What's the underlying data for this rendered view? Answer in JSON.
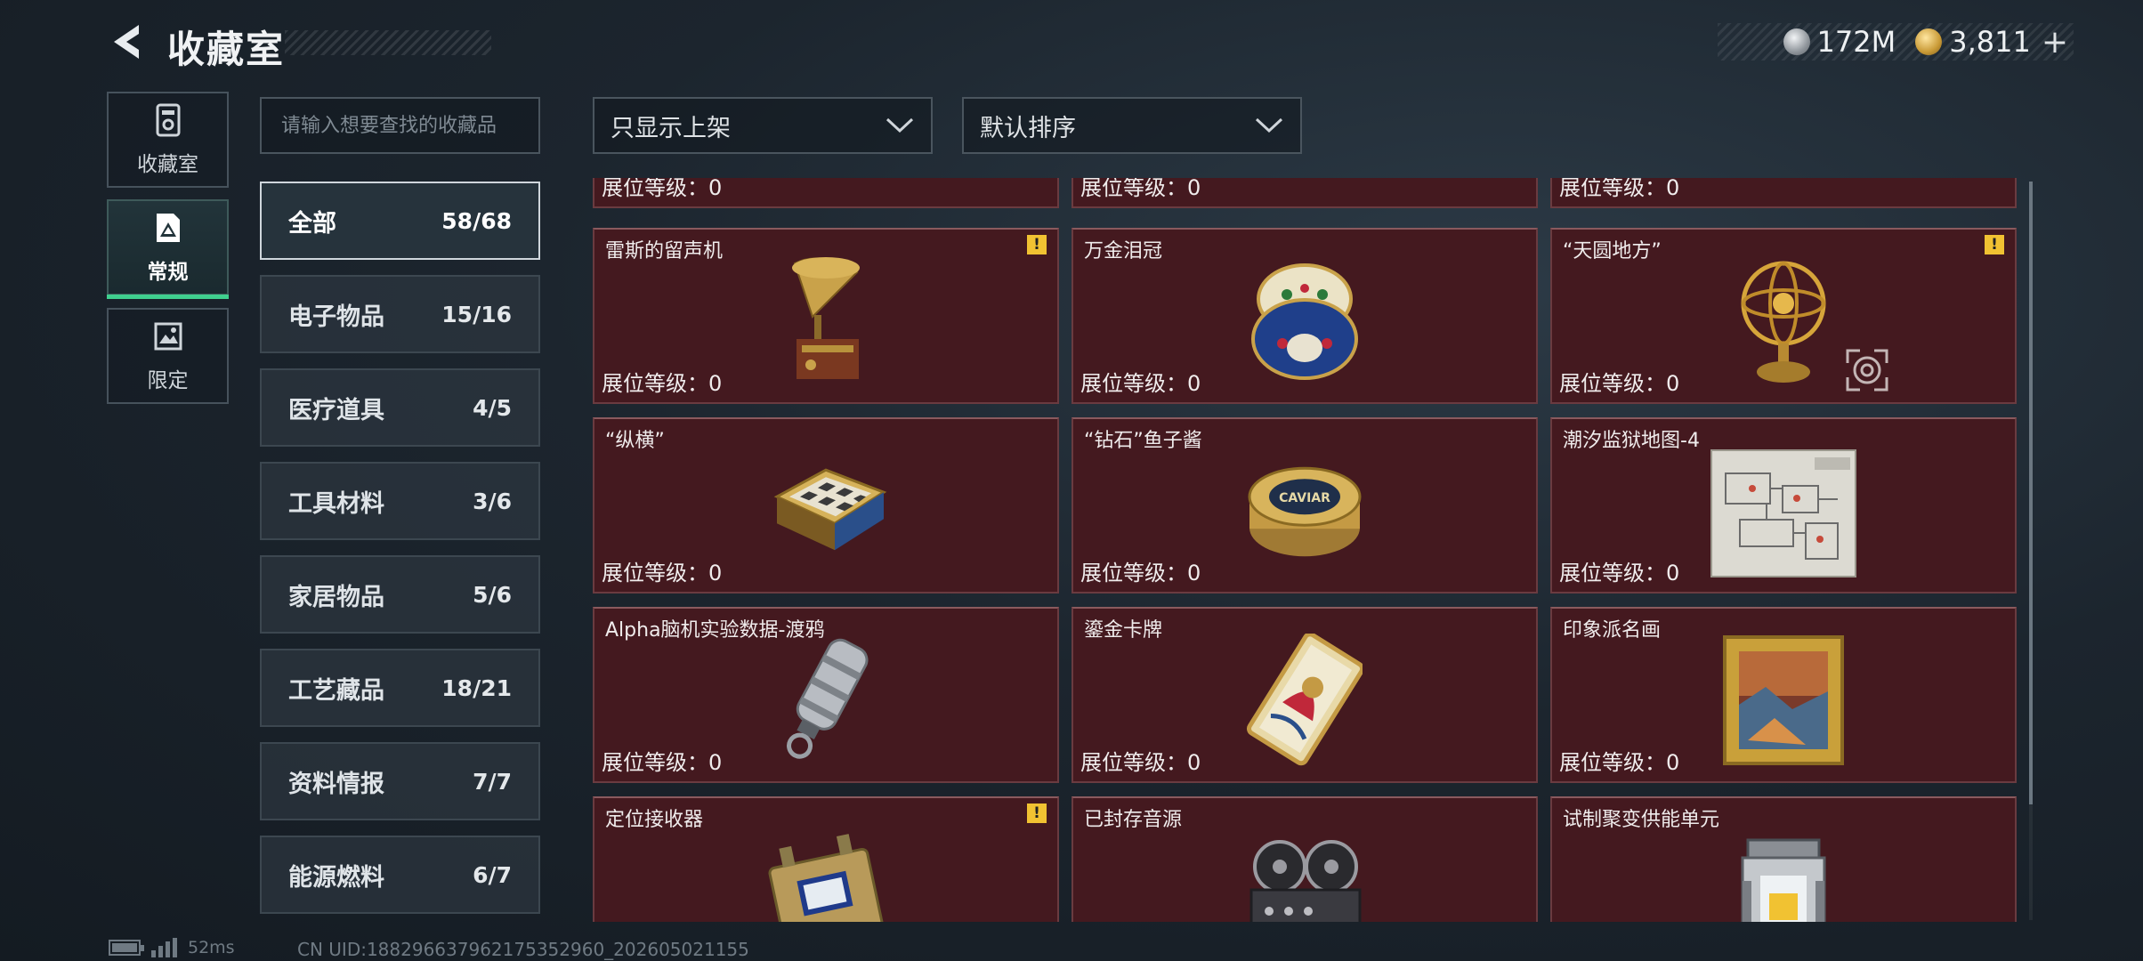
{
  "header": {
    "title": "收藏室",
    "currencies": [
      {
        "icon": "silver-coin-icon",
        "value": "172M"
      },
      {
        "icon": "gold-token-icon",
        "value": "3,811"
      }
    ],
    "add_symbol": "+"
  },
  "modes": [
    {
      "label": "收藏室",
      "icon": "collection-room-icon"
    },
    {
      "label": "常规",
      "icon": "regular-tab-icon",
      "active": true
    },
    {
      "label": "限定",
      "icon": "limited-tab-icon"
    }
  ],
  "search": {
    "placeholder": "请输入想要查找的收藏品"
  },
  "filters": {
    "availability": "只显示上架",
    "sort": "默认排序"
  },
  "categories": [
    {
      "name": "全部",
      "count": "58/68",
      "active": true
    },
    {
      "name": "电子物品",
      "count": "15/16"
    },
    {
      "name": "医疗道具",
      "count": "4/5"
    },
    {
      "name": "工具材料",
      "count": "3/6"
    },
    {
      "name": "家居物品",
      "count": "5/6"
    },
    {
      "name": "工艺藏品",
      "count": "18/21"
    },
    {
      "name": "资料情报",
      "count": "7/7"
    },
    {
      "name": "能源燃料",
      "count": "6/7"
    }
  ],
  "level_prefix": "展位等级：",
  "items": [
    {
      "name": "",
      "level": "0"
    },
    {
      "name": "",
      "level": "0"
    },
    {
      "name": "",
      "level": "0"
    },
    {
      "name": "雷斯的留声机",
      "level": "0",
      "alert": "!"
    },
    {
      "name": "万金泪冠",
      "level": "0"
    },
    {
      "name": "“天圆地方”",
      "level": "0",
      "alert": "!"
    },
    {
      "name": "“纵横”",
      "level": "0"
    },
    {
      "name": "“钻石”鱼子酱",
      "level": "0",
      "art_text": "CAVIAR"
    },
    {
      "name": "潮汐监狱地图-4",
      "level": "0"
    },
    {
      "name": "Alpha脑机实验数据-渡鸦",
      "level": "0"
    },
    {
      "name": "鎏金卡牌",
      "level": "0"
    },
    {
      "name": "印象派名画",
      "level": "0"
    },
    {
      "name": "定位接收器",
      "level": "",
      "alert": "!"
    },
    {
      "name": "已封存音源",
      "level": ""
    },
    {
      "name": "试制聚变供能单元",
      "level": ""
    }
  ],
  "footer": {
    "ping": "52ms",
    "uid": "CN UID:18829663796217535296​0_202605021155"
  }
}
